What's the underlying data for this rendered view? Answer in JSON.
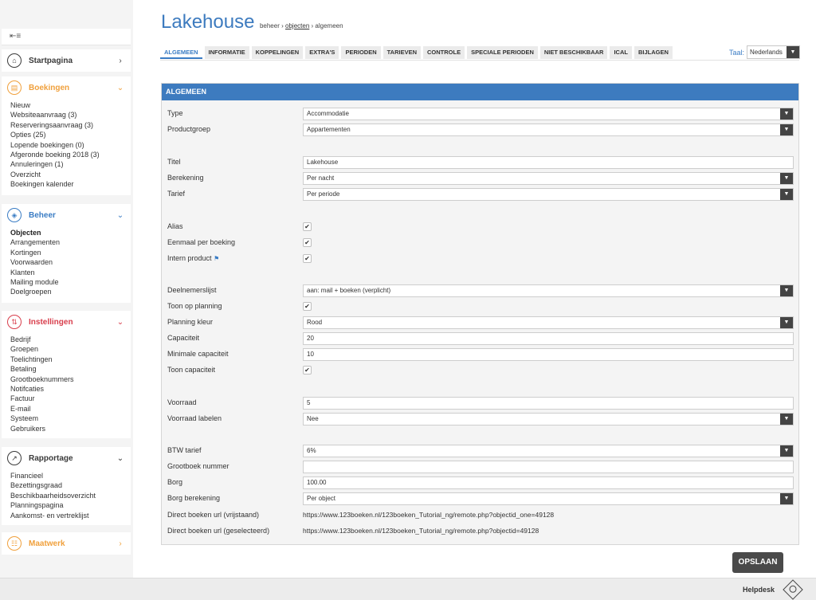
{
  "header": {
    "title": "Lakehouse",
    "crumb_root": "beheer",
    "crumb_sep": "›",
    "crumb_link": "objecten",
    "crumb_current": "algemeen"
  },
  "sidebar": {
    "toggle_icon": "list-collapse-icon",
    "startpagina": {
      "title": "Startpagina",
      "icon": "home-icon"
    },
    "boekingen": {
      "title": "Boekingen",
      "icon": "booking-icon",
      "color": "#f0a03c",
      "items": [
        "Nieuw",
        "Websiteaanvraag (3)",
        "Reserveringsaanvraag (3)",
        "Opties (25)",
        "Lopende boekingen (0)",
        "Afgeronde boeking 2018 (3)",
        "Annuleringen (1)",
        "Overzicht",
        "Boekingen kalender"
      ]
    },
    "beheer": {
      "title": "Beheer",
      "icon": "manage-icon",
      "color": "#3a7cc4",
      "items": [
        "Objecten",
        "Arrangementen",
        "Kortingen",
        "Voorwaarden",
        "Klanten",
        "Mailing module",
        "Doelgroepen"
      ]
    },
    "instellingen": {
      "title": "Instellingen",
      "icon": "settings-icon",
      "color": "#d83e4c",
      "items": [
        "Bedrijf",
        "Groepen",
        "Toelichtingen",
        "Betaling",
        "Grootboeknummers",
        "Notifcaties",
        "Factuur",
        "E-mail",
        "Systeem",
        "Gebruikers"
      ]
    },
    "rapportage": {
      "title": "Rapportage",
      "icon": "chart-icon",
      "items": [
        "Financieel",
        "Bezettingsgraad",
        "Beschikbaarheidsoverzicht",
        "Planningspagina",
        "Aankomst- en vertreklijst"
      ]
    },
    "maatwerk": {
      "title": "Maatwerk",
      "icon": "custom-icon",
      "color": "#f0a03c"
    }
  },
  "tabs": [
    "ALGEMEEN",
    "INFORMATIE",
    "KOPPELINGEN",
    "EXTRA'S",
    "PERIODEN",
    "TARIEVEN",
    "CONTROLE",
    "SPECIALE PERIODEN",
    "NIET BESCHIKBAAR",
    "ICAL",
    "BIJLAGEN"
  ],
  "language": {
    "label": "Taal:",
    "value": "Nederlands"
  },
  "panel": {
    "title": "ALGEMEEN",
    "type": {
      "label": "Type",
      "value": "Accommodatie"
    },
    "productgroep": {
      "label": "Productgroep",
      "value": "Appartementen"
    },
    "titel": {
      "label": "Titel",
      "value": "Lakehouse"
    },
    "berekening": {
      "label": "Berekening",
      "value": "Per nacht"
    },
    "tarief": {
      "label": "Tarief",
      "value": "Per periode"
    },
    "alias": {
      "label": "Alias",
      "checked": "✔"
    },
    "eenmaal": {
      "label": "Eenmaal per boeking",
      "checked": "✔"
    },
    "intern": {
      "label": "Intern product",
      "checked": "✔"
    },
    "deelnemers": {
      "label": "Deelnemerslijst",
      "value": "aan: mail + boeken (verplicht)"
    },
    "toon_planning": {
      "label": "Toon op planning",
      "checked": "✔"
    },
    "planning_kleur": {
      "label": "Planning kleur",
      "value": "Rood"
    },
    "capaciteit": {
      "label": "Capaciteit",
      "value": "20"
    },
    "min_capaciteit": {
      "label": "Minimale capaciteit",
      "value": "10"
    },
    "toon_capaciteit": {
      "label": "Toon capaciteit",
      "checked": "✔"
    },
    "voorraad": {
      "label": "Voorraad",
      "value": "5"
    },
    "voorraad_labelen": {
      "label": "Voorraad labelen",
      "value": "Nee"
    },
    "btw": {
      "label": "BTW tarief",
      "value": "6%"
    },
    "grootboek": {
      "label": "Grootboek nummer",
      "value": ""
    },
    "borg": {
      "label": "Borg",
      "value": "100.00"
    },
    "borg_berekening": {
      "label": "Borg berekening",
      "value": "Per object"
    },
    "url_vrij": {
      "label": "Direct boeken url (vrijstaand)",
      "value": "https://www.123boeken.nl/123boeken_Tutorial_ng/remote.php?objectid_one=49128"
    },
    "url_gesel": {
      "label": "Direct boeken url (geselecteerd)",
      "value": "https://www.123boeken.nl/123boeken_Tutorial_ng/remote.php?objectid=49128"
    }
  },
  "save_label": "OPSLAAN",
  "footer": {
    "helpdesk": "Helpdesk"
  }
}
